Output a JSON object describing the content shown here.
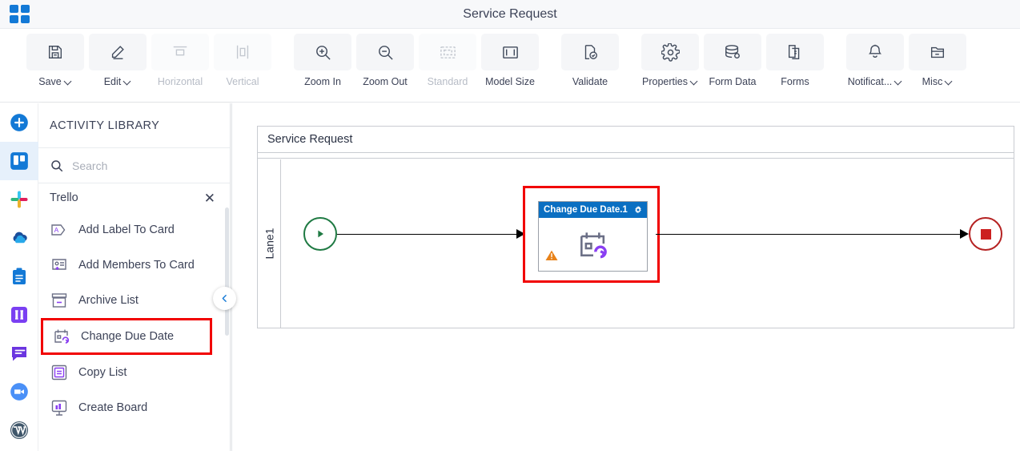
{
  "window": {
    "title": "Service Request",
    "logo_icon": "grid-2x2-icon",
    "accent_color": "#1379d6"
  },
  "toolbar": {
    "items": [
      {
        "label": "Save",
        "icon": "floppy-disk-icon",
        "caret": true,
        "disabled": false
      },
      {
        "label": "Edit",
        "icon": "pencil-icon",
        "caret": true,
        "disabled": false
      },
      {
        "label": "Horizontal",
        "icon": "align-horizontal-icon",
        "caret": false,
        "disabled": true
      },
      {
        "label": "Vertical",
        "icon": "align-vertical-icon",
        "caret": false,
        "disabled": true
      },
      {
        "label": "Zoom In",
        "icon": "zoom-in-icon",
        "caret": false,
        "disabled": false
      },
      {
        "label": "Zoom Out",
        "icon": "zoom-out-icon",
        "caret": false,
        "disabled": false
      },
      {
        "label": "Standard",
        "icon": "fit-standard-icon",
        "caret": false,
        "disabled": true
      },
      {
        "label": "Model Size",
        "icon": "fit-model-size-icon",
        "caret": false,
        "disabled": false
      },
      {
        "label": "Validate",
        "icon": "validate-document-icon",
        "caret": false,
        "disabled": false
      },
      {
        "label": "Properties",
        "icon": "gear-icon",
        "caret": true,
        "disabled": false
      },
      {
        "label": "Form Data",
        "icon": "database-icon",
        "caret": false,
        "disabled": false
      },
      {
        "label": "Forms",
        "icon": "document-icon",
        "caret": false,
        "disabled": false
      },
      {
        "label": "Notificat...",
        "icon": "bell-icon",
        "caret": true,
        "disabled": false
      },
      {
        "label": "Misc",
        "icon": "folder-icon",
        "caret": true,
        "disabled": false
      }
    ]
  },
  "rail": {
    "items": [
      {
        "name": "add-connector",
        "icon": "plus-circle-icon",
        "active": false
      },
      {
        "name": "trello",
        "icon": "trello-icon",
        "active": true
      },
      {
        "name": "slack",
        "icon": "slack-icon",
        "active": false
      },
      {
        "name": "onedrive",
        "icon": "onedrive-cloud-icon",
        "active": false
      },
      {
        "name": "asana",
        "icon": "clipboard-icon",
        "active": false
      },
      {
        "name": "jira",
        "icon": "jira-columns-icon",
        "active": false
      },
      {
        "name": "chat",
        "icon": "chat-bubble-icon",
        "active": false
      },
      {
        "name": "zoom",
        "icon": "video-camera-icon",
        "active": false
      },
      {
        "name": "wordpress",
        "icon": "wordpress-icon",
        "active": false
      }
    ]
  },
  "activity_library": {
    "heading": "ACTIVITY LIBRARY",
    "search": {
      "placeholder": "Search",
      "value": "",
      "icon": "search-icon"
    },
    "group": {
      "name": "Trello",
      "close_icon": "close-icon"
    },
    "activities": [
      {
        "label": "Add Label To Card",
        "icon": "label-tag-icon",
        "highlight": false
      },
      {
        "label": "Add Members To Card",
        "icon": "member-add-icon",
        "highlight": false
      },
      {
        "label": "Archive List",
        "icon": "archive-box-icon",
        "highlight": false
      },
      {
        "label": "Change Due Date",
        "icon": "calendar-refresh-icon",
        "highlight": true
      },
      {
        "label": "Copy List",
        "icon": "copy-list-icon",
        "highlight": false
      },
      {
        "label": "Create Board",
        "icon": "board-chart-icon",
        "highlight": false
      }
    ],
    "collapse_icon": "chevron-left-icon"
  },
  "canvas": {
    "pool_title": "Service Request",
    "lane_label": "Lane1",
    "start_event": {
      "name": "start-event",
      "icon": "play-triangle-icon",
      "color": "#1f7a43"
    },
    "end_event": {
      "name": "end-event",
      "icon": "stop-square-icon",
      "color": "#b52222"
    },
    "task": {
      "name": "Change Due Date.1",
      "icon": "calendar-refresh-icon",
      "settings_icon": "gear-icon",
      "warning_icon": "warning-triangle-icon",
      "header_color": "#0a6fc2",
      "selection_color": "#f10000"
    }
  }
}
